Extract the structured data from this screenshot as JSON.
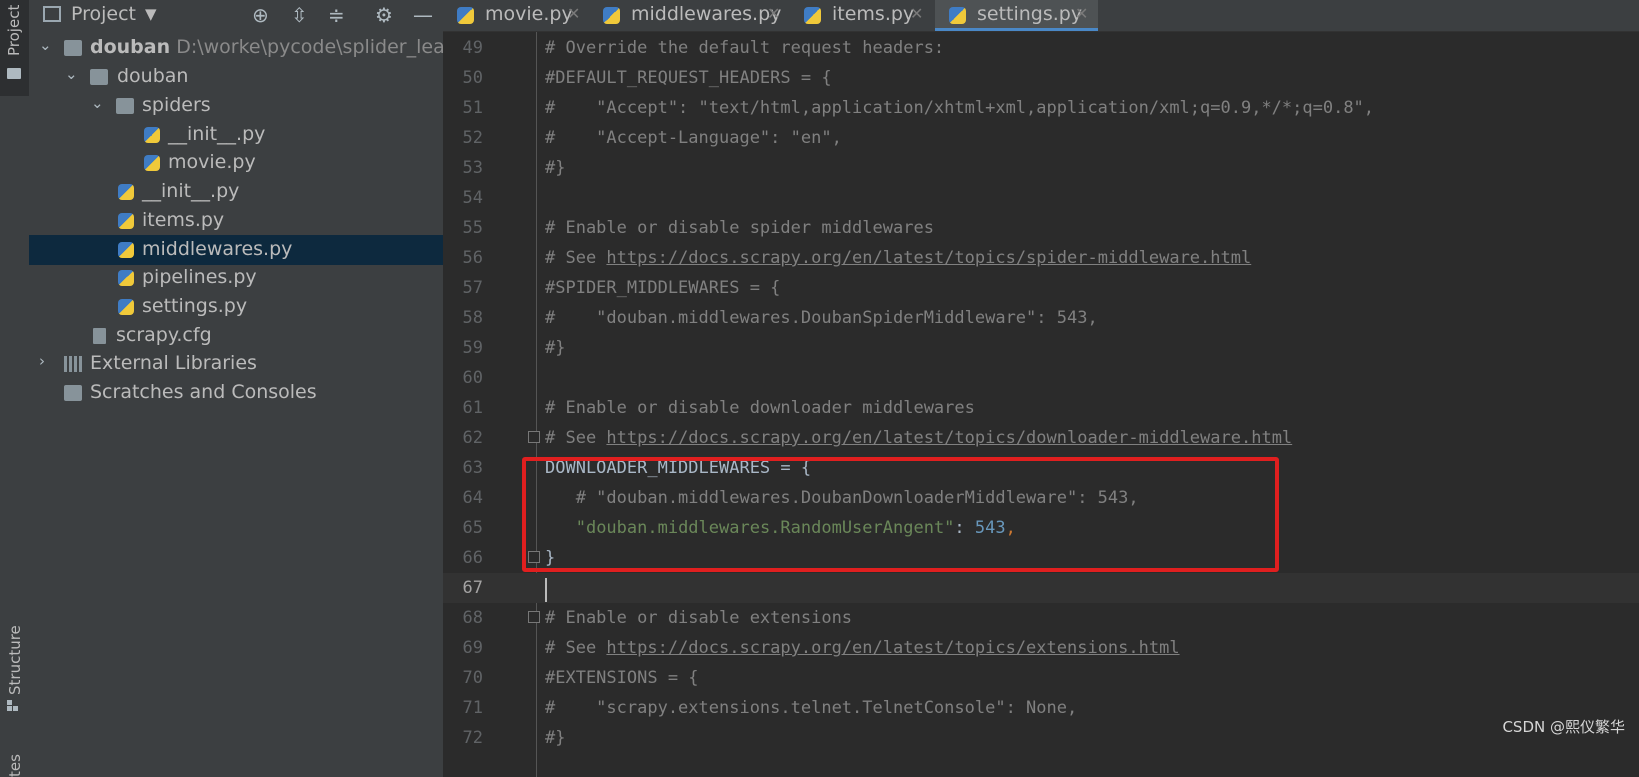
{
  "toolstrip": {
    "project_tab": "Project",
    "structure_tab": "Structure",
    "bottom_tab": "tes"
  },
  "project_panel": {
    "title": "Project",
    "tree": [
      {
        "label": "douban",
        "path": "D:\\worke\\pycode\\splider_learn\\do"
      },
      {
        "label": "douban"
      },
      {
        "label": "spiders"
      },
      {
        "label": "__init__.py"
      },
      {
        "label": "movie.py"
      },
      {
        "label": "__init__.py"
      },
      {
        "label": "items.py"
      },
      {
        "label": "middlewares.py"
      },
      {
        "label": "pipelines.py"
      },
      {
        "label": "settings.py"
      },
      {
        "label": "scrapy.cfg"
      },
      {
        "label": "External Libraries"
      },
      {
        "label": "Scratches and Consoles"
      }
    ]
  },
  "tabs": [
    {
      "label": "movie.py"
    },
    {
      "label": "middlewares.py"
    },
    {
      "label": "items.py"
    },
    {
      "label": "settings.py"
    }
  ],
  "editor": {
    "lines": [
      {
        "n": "49",
        "text": "# Override the default request headers:"
      },
      {
        "n": "50",
        "text": "#DEFAULT_REQUEST_HEADERS = {"
      },
      {
        "n": "51",
        "text": "#    \"Accept\": \"text/html,application/xhtml+xml,application/xml;q=0.9,*/*;q=0.8\","
      },
      {
        "n": "52",
        "text": "#    \"Accept-Language\": \"en\","
      },
      {
        "n": "53",
        "text": "#}"
      },
      {
        "n": "54",
        "text": ""
      },
      {
        "n": "55",
        "text": "# Enable or disable spider middlewares"
      },
      {
        "n": "56",
        "text": "# See ",
        "url": "https://docs.scrapy.org/en/latest/topics/spider-middleware.html"
      },
      {
        "n": "57",
        "text": "#SPIDER_MIDDLEWARES = {"
      },
      {
        "n": "58",
        "text": "#    \"douban.middlewares.DoubanSpiderMiddleware\": 543,"
      },
      {
        "n": "59",
        "text": "#}"
      },
      {
        "n": "60",
        "text": ""
      },
      {
        "n": "61",
        "text": "# Enable or disable downloader middlewares"
      },
      {
        "n": "62",
        "text": "# See ",
        "url": "https://docs.scrapy.org/en/latest/topics/downloader-middleware.html"
      },
      {
        "n": "63",
        "text": "DOWNLOADER_MIDDLEWARES = {"
      },
      {
        "n": "64",
        "text": "   # \"douban.middlewares.DoubanDownloaderMiddleware\": 543,"
      },
      {
        "n": "65",
        "text": "   ",
        "str": "\"douban.middlewares.RandomUserAngent\"",
        "after": ": ",
        "num": "543",
        "comma": ","
      },
      {
        "n": "66",
        "text": "}"
      },
      {
        "n": "67",
        "text": ""
      },
      {
        "n": "68",
        "text": "# Enable or disable extensions"
      },
      {
        "n": "69",
        "text": "# See ",
        "url": "https://docs.scrapy.org/en/latest/topics/extensions.html"
      },
      {
        "n": "70",
        "text": "#EXTENSIONS = {"
      },
      {
        "n": "71",
        "text": "#    \"scrapy.extensions.telnet.TelnetConsole\": None,"
      },
      {
        "n": "72",
        "text": "#}"
      }
    ]
  },
  "watermark": "CSDN @熙仪繁华"
}
